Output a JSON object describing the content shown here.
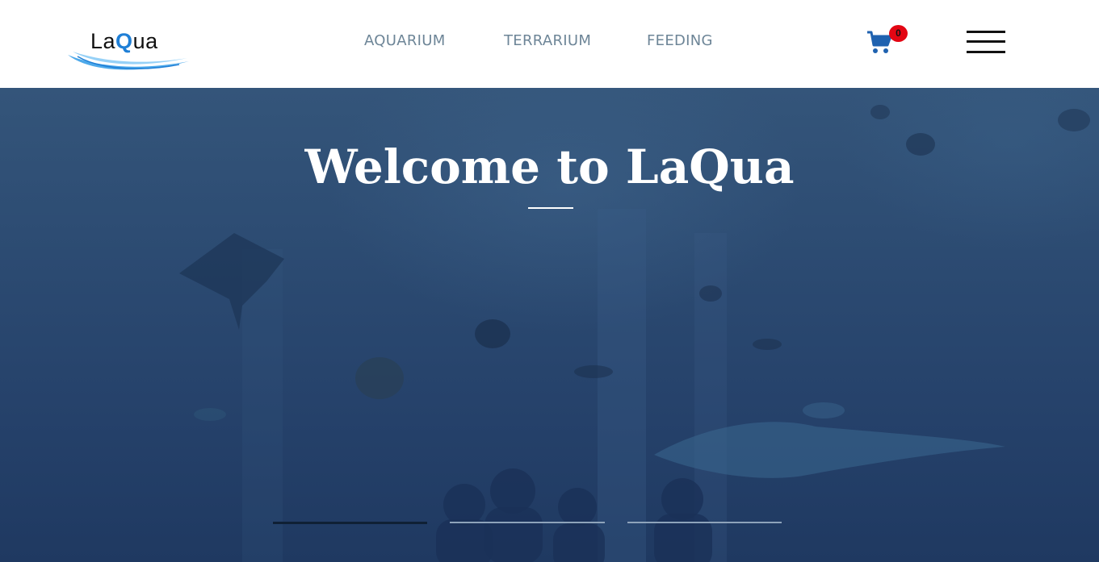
{
  "header": {
    "logo_text_before": "La",
    "logo_text_q": "Q",
    "logo_text_after": "ua",
    "nav": [
      {
        "label": "AQUARIUM"
      },
      {
        "label": "TERRARIUM"
      },
      {
        "label": "FEEDING"
      }
    ],
    "cart_count": "0",
    "cart_icon": "shopping-cart-icon",
    "menu_icon": "hamburger-menu-icon"
  },
  "hero": {
    "title": "Welcome to LaQua",
    "slides": [
      {
        "active": true
      },
      {
        "active": false
      },
      {
        "active": false
      }
    ]
  },
  "colors": {
    "nav_text": "#6d8597",
    "cart_icon": "#1f62b0",
    "badge": "#e30613",
    "logo_accent": "#1f7fd6",
    "hero_bg": "#2c4b72"
  }
}
